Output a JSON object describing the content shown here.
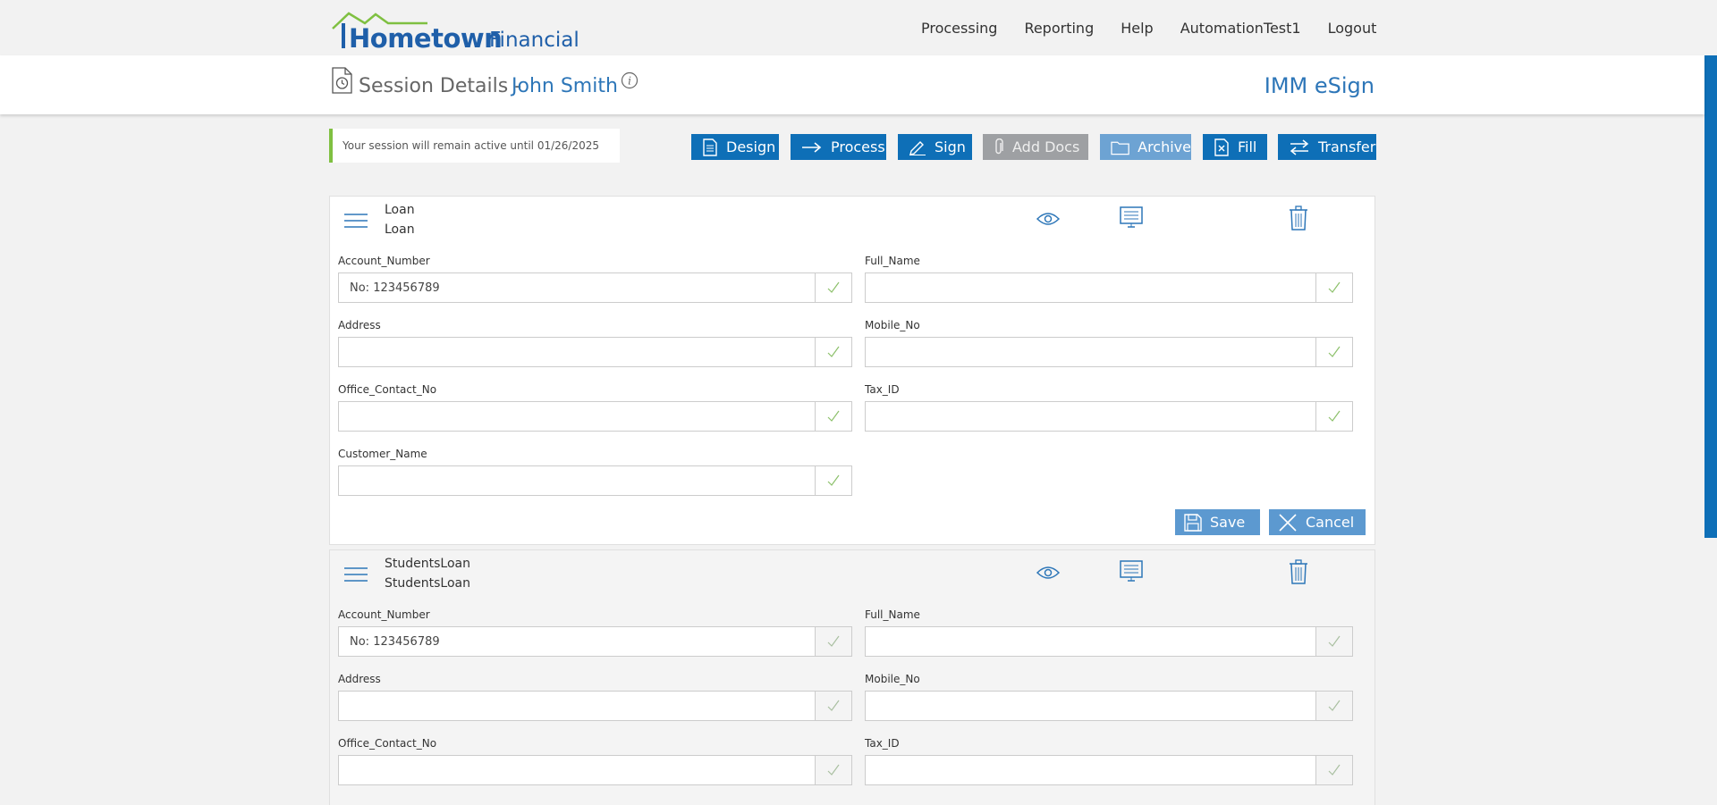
{
  "header": {
    "brand_main": "Hometown",
    "brand_sub": "Financial",
    "nav": [
      "Processing",
      "Reporting",
      "Help",
      "AutomationTest1",
      "Logout"
    ]
  },
  "subheader": {
    "title": "Session Details -",
    "name": "John Smith",
    "app_name": "IMM eSign"
  },
  "session_note": "Your session will remain active until 01/26/2025",
  "toolbar": {
    "buttons": [
      "Design",
      "Process",
      "Sign",
      "Add Docs",
      "Archive",
      "Fill",
      "Transfer"
    ]
  },
  "forms": [
    {
      "title": "Loan",
      "subtitle": "Loan",
      "fields": [
        {
          "label": "Account_Number",
          "value": "No: 123456789"
        },
        {
          "label": "Full_Name",
          "value": ""
        },
        {
          "label": "Address",
          "value": ""
        },
        {
          "label": "Mobile_No",
          "value": ""
        },
        {
          "label": "Office_Contact_No",
          "value": ""
        },
        {
          "label": "Tax_ID",
          "value": ""
        },
        {
          "label": "Customer_Name",
          "value": ""
        }
      ],
      "save_label": "Save",
      "cancel_label": "Cancel"
    },
    {
      "title": "StudentsLoan",
      "subtitle": "StudentsLoan",
      "fields": [
        {
          "label": "Account_Number",
          "value": "No: 123456789"
        },
        {
          "label": "Full_Name",
          "value": ""
        },
        {
          "label": "Address",
          "value": ""
        },
        {
          "label": "Mobile_No",
          "value": ""
        },
        {
          "label": "Office_Contact_No",
          "value": ""
        },
        {
          "label": "Tax_ID",
          "value": ""
        }
      ]
    }
  ],
  "colors": {
    "primary_blue": "#0e6fb7",
    "light_blue": "#5c99d0",
    "disabled_gray": "#9ea0a3",
    "accent_green": "#7fc041"
  },
  "icons": [
    "house-logo-icon",
    "document-history-icon",
    "info-icon",
    "design-list-icon",
    "arrow-right-icon",
    "pen-icon",
    "paperclip-icon",
    "folder-icon",
    "fill-doc-icon",
    "transfer-arrows-icon",
    "hamburger-icon",
    "eye-icon",
    "monitor-icon",
    "trash-icon",
    "check-icon",
    "save-disk-icon",
    "close-x-icon"
  ]
}
